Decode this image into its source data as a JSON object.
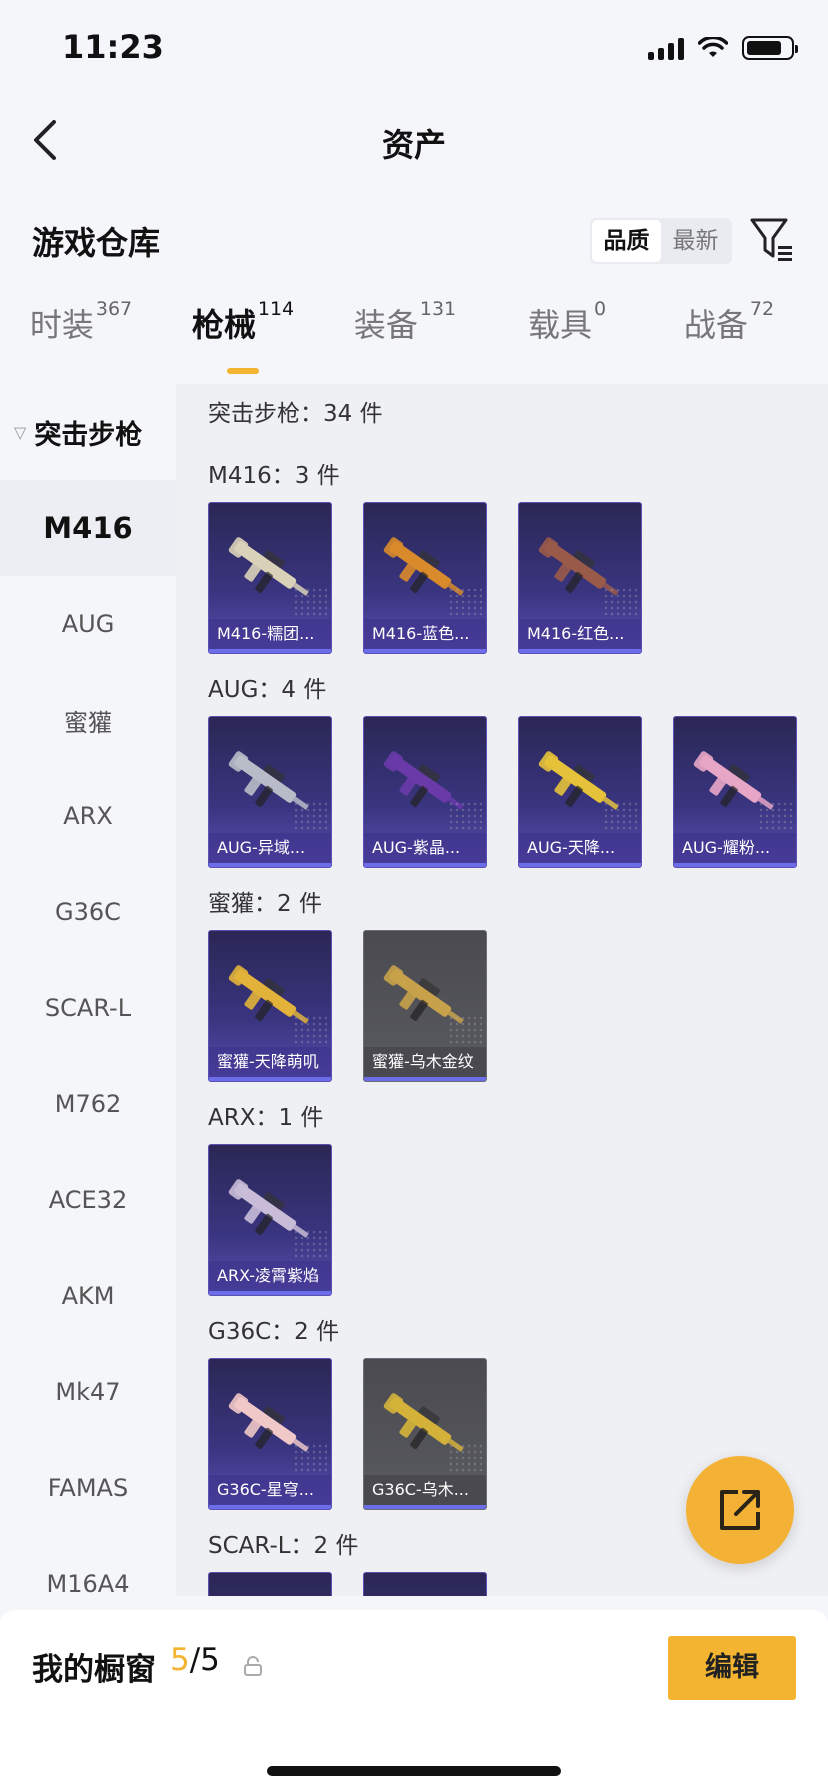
{
  "status": {
    "time": "11:23"
  },
  "nav": {
    "title": "资产"
  },
  "header": {
    "title": "游戏仓库",
    "sort_options": [
      "品质",
      "最新"
    ]
  },
  "tabs": [
    {
      "label": "时装",
      "count": "367"
    },
    {
      "label": "枪械",
      "count": "114"
    },
    {
      "label": "装备",
      "count": "131"
    },
    {
      "label": "载具",
      "count": "0"
    },
    {
      "label": "战备",
      "count": "72"
    }
  ],
  "sidebar": {
    "group": "突击步枪",
    "items": [
      "M416",
      "AUG",
      "蜜獾",
      "ARX",
      "G36C",
      "SCAR-L",
      "M762",
      "ACE32",
      "AKM",
      "Mk47",
      "FAMAS",
      "M16A4"
    ]
  },
  "content": {
    "header": "突击步枪：34 件",
    "sections": [
      {
        "title": "M416：3 件",
        "items": [
          {
            "name": "M416-糯团...",
            "style": "purple",
            "gun": "#d9d2b8"
          },
          {
            "name": "M416-蓝色...",
            "style": "purple",
            "gun": "#d98a2b"
          },
          {
            "name": "M416-红色...",
            "style": "purple",
            "gun": "#9a5a4a"
          }
        ]
      },
      {
        "title": "AUG：4 件",
        "items": [
          {
            "name": "AUG-异域...",
            "style": "purple",
            "gun": "#b8bcc8"
          },
          {
            "name": "AUG-紫晶...",
            "style": "purple",
            "gun": "#6a3aa8"
          },
          {
            "name": "AUG-天降...",
            "style": "purple",
            "gun": "#e6c23a"
          },
          {
            "name": "AUG-耀粉...",
            "style": "purple",
            "gun": "#e8a6c6"
          }
        ]
      },
      {
        "title": "蜜獾：2 件",
        "items": [
          {
            "name": "蜜獾-天降萌叽",
            "style": "purple",
            "gun": "#e2b23a"
          },
          {
            "name": "蜜獾-乌木金纹",
            "style": "grey",
            "gun": "#c8a24a"
          }
        ]
      },
      {
        "title": "ARX：1 件",
        "items": [
          {
            "name": "ARX-凌霄紫焰",
            "style": "purple",
            "gun": "#c8bcd8"
          }
        ]
      },
      {
        "title": "G36C：2 件",
        "items": [
          {
            "name": "G36C-星穹...",
            "style": "purple",
            "gun": "#f0c8c8"
          },
          {
            "name": "G36C-乌木...",
            "style": "grey",
            "gun": "#d4b23a"
          }
        ]
      },
      {
        "title": "SCAR-L：2 件",
        "items": [
          {
            "name": "",
            "style": "purple",
            "gun": "#b8b8c8"
          },
          {
            "name": "",
            "style": "purple",
            "gun": "#b8b8c8"
          }
        ]
      }
    ]
  },
  "bottom": {
    "showcase_label": "我的橱窗",
    "showcase_used": "5",
    "showcase_total": "/5",
    "edit_label": "编辑"
  },
  "colors": {
    "accent": "#f2b431",
    "card_purple": "#3a3580",
    "card_grey": "#55565c"
  }
}
